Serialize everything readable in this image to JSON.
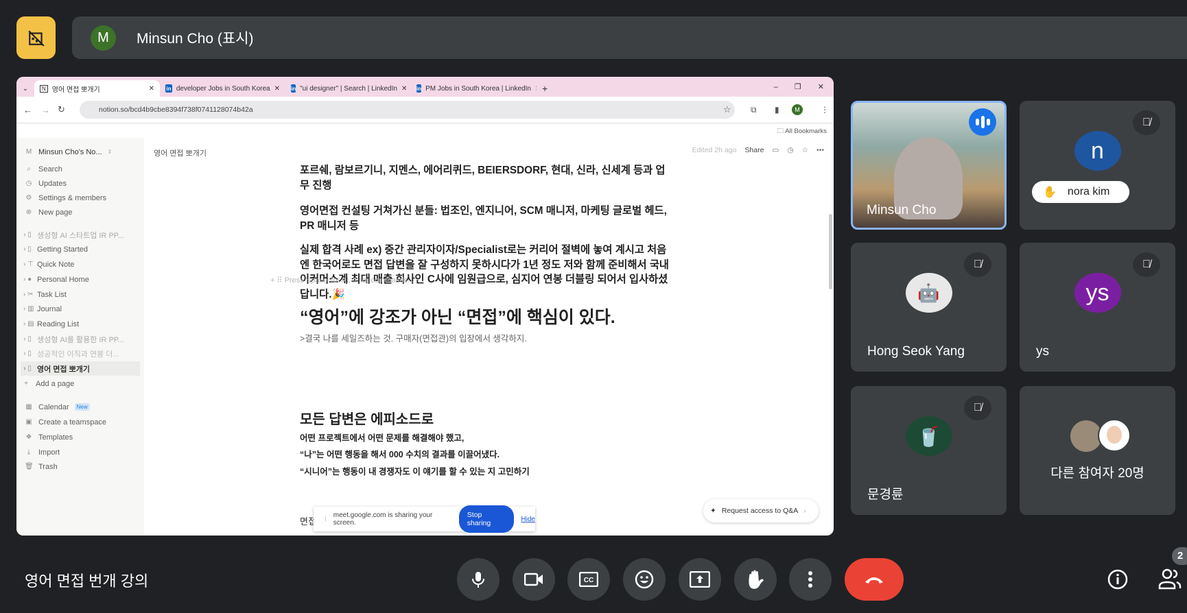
{
  "top": {
    "presenter_initial": "M",
    "presenter_label": "Minsun Cho (표시)"
  },
  "browser": {
    "tabs": [
      {
        "label": "영어 면접 뽀개기",
        "active": true
      },
      {
        "label": "developer Jobs in South Korea"
      },
      {
        "label": "\"ui designer\" | Search | LinkedIn"
      },
      {
        "label": "PM Jobs in South Korea | LinkedIn"
      }
    ],
    "url": "notion.so/bcd4b9cbe8394f738f0741128074b42a",
    "profile_initial": "M",
    "bookmarks": "All Bookmarks"
  },
  "notion": {
    "workspace": "Minsun Cho's No...",
    "workspace_initial": "M",
    "nav": [
      {
        "label": "Search",
        "icon": "search-icon"
      },
      {
        "label": "Updates",
        "icon": "clock-icon"
      },
      {
        "label": "Settings & members",
        "icon": "gear-icon"
      },
      {
        "label": "New page",
        "icon": "plus-circle-icon"
      }
    ],
    "pages": [
      "생성형 AI 스타트업 IR PP...",
      "Getting Started",
      "Quick Note",
      "Personal Home",
      "Task List",
      "Journal",
      "Reading List",
      "생성형 AI를 활용한 IR PP...",
      "성공적인 이직과 연봉 더...",
      "영어 면접 뽀개기"
    ],
    "add_page": "Add a page",
    "bottom": [
      {
        "label": "Calendar",
        "badge": "New"
      },
      {
        "label": "Create a teamspace"
      },
      {
        "label": "Templates"
      },
      {
        "label": "Import"
      },
      {
        "label": "Trash"
      }
    ],
    "breadcrumb": "영어 면접 뽀개기",
    "edited": "Edited 2h ago",
    "share": "Share",
    "p1": "포르쉐, 람보르기니, 지멘스, 에어리퀴드, BEIERSDORF, 현대, 신라, 신세계 등과 업무 진행",
    "p2": "영어면접 컨설팅 거쳐가신 분들: 법조인, 엔지니어, SCM 매니저, 마케팅 글로벌 헤드, PR 매니저 등",
    "p3": "실제 합격 사례 ex) 중간 관리자이자/Specialist로는 커리어 절벽에 놓여 계시고 처음엔 한국어로도 면접 답변을 잘 구성하지 못하시다가 1년 정도 저와 함께 준비해서 국내 이커머스계 최대 매출 회사인 C사에 임원급으로, 심지어 연봉 더블링 되어서 입사하셨답니다.🎉",
    "placeholder": "Press 'space' for AI, '/' for commands...",
    "h1": "“영어”에 강조가 아닌 “면접”에 핵심이 있다.",
    "quote": ">결국 나를 세일즈하는 것. 구매자(면접관)의 입장에서 생각하지.",
    "h2": "모든 답변은 에피소드로",
    "lines": [
      "어떤 프로젝트에서 어떤 문제를 해결해야 했고,",
      "“나”는 어떤 행동을 해서 000 수치의 결과를 이끌어냈다.",
      "“시니어”는 행동이 내 경쟁자도 이 얘기를 할 수 있는 지 고민하기"
    ],
    "bottom_text": "면접",
    "qa": "Request access to Q&A"
  },
  "share_bar": {
    "text": "meet.google.com is sharing your screen.",
    "stop": "Stop sharing",
    "hide": "Hide"
  },
  "participants": [
    {
      "name": "Minsun Cho",
      "type": "video",
      "speaking": true
    },
    {
      "name": "nora kim",
      "initial": "n",
      "color": "#1e56a0",
      "hand_raised": true,
      "muted": true
    },
    {
      "name": "Hong Seok Yang",
      "muted": true
    },
    {
      "name": "ys",
      "initial": "ys",
      "color": "#7b1fa2",
      "muted": true
    },
    {
      "name": "문경륜",
      "muted": true
    },
    {
      "name": "다른 참여자 20명"
    }
  ],
  "bottom": {
    "meeting_title": "영어 면접 번개 강의",
    "people_badge": "2"
  },
  "colors": {
    "leave": "#ea4335",
    "accent": "#8ab4f8",
    "tile": "#3c4043"
  }
}
